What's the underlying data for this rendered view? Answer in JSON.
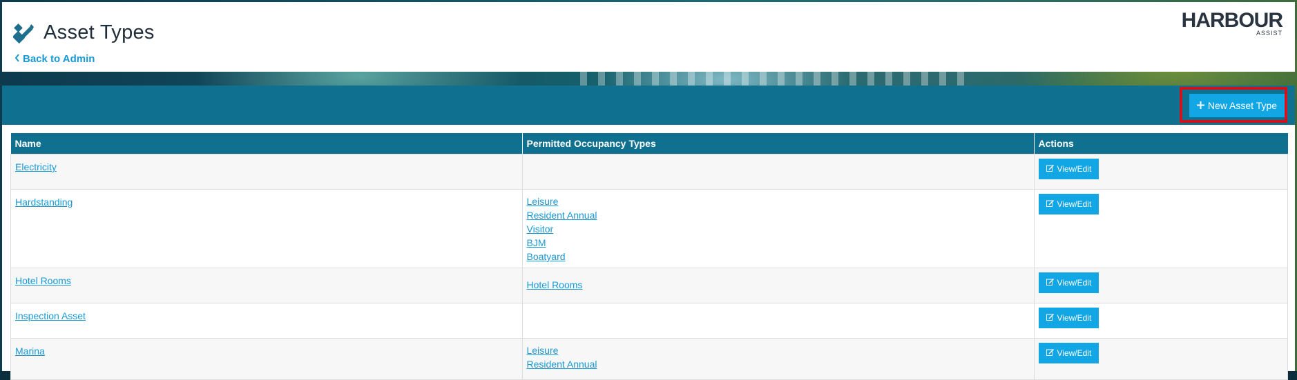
{
  "header": {
    "title": "Asset Types",
    "back_label": "Back to Admin",
    "logo_main": "HARBOUR",
    "logo_sub": "ASSIST"
  },
  "toolbar": {
    "new_button_label": "New Asset Type"
  },
  "table": {
    "columns": [
      "Name",
      "Permitted Occupancy Types",
      "Actions"
    ],
    "rows": [
      {
        "name": "Electricity",
        "occupancy_types": [],
        "action": "View/Edit"
      },
      {
        "name": "Hardstanding",
        "occupancy_types": [
          "Leisure",
          "Resident Annual",
          "Visitor",
          "BJM",
          "Boatyard"
        ],
        "action": "View/Edit"
      },
      {
        "name": "Hotel Rooms",
        "occupancy_types": [
          "Hotel Rooms"
        ],
        "action": "View/Edit"
      },
      {
        "name": "Inspection Asset",
        "occupancy_types": [],
        "action": "View/Edit"
      },
      {
        "name": "Marina",
        "occupancy_types": [
          "Leisure",
          "Resident Annual"
        ],
        "action": "View/Edit"
      }
    ]
  },
  "colors": {
    "brand_blue": "#10708f",
    "button_blue": "#13a6e4",
    "link_blue": "#1899d5",
    "highlight_red": "#d1121d"
  }
}
